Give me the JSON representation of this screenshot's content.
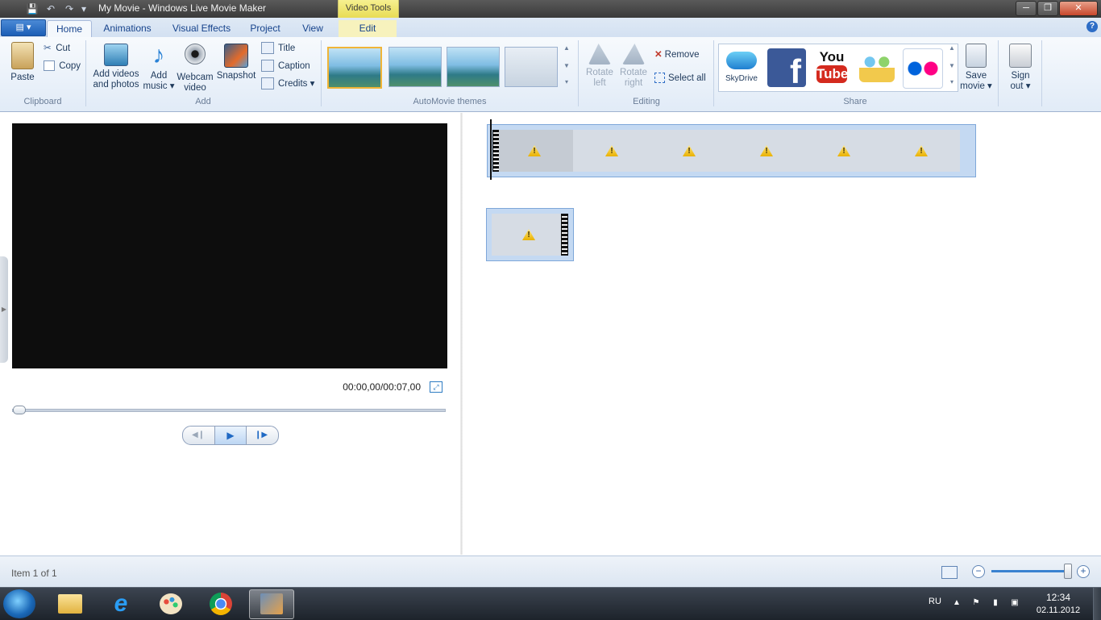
{
  "window": {
    "title": "My Movie - Windows Live Movie Maker",
    "contextual_tab_group": "Video Tools",
    "controls": {
      "minimize": "─",
      "maximize": "❐",
      "close": "✕"
    }
  },
  "quick_access": {
    "save_icon": "💾",
    "undo_icon": "↶",
    "redo_icon": "↷",
    "customize_icon": "▾"
  },
  "ribbon_tabs": [
    {
      "label": "Home",
      "active": true
    },
    {
      "label": "Animations",
      "active": false
    },
    {
      "label": "Visual Effects",
      "active": false
    },
    {
      "label": "Project",
      "active": false
    },
    {
      "label": "View",
      "active": false
    },
    {
      "label": "Edit",
      "active": false
    }
  ],
  "app_menu": {
    "icon": "▤ ▾"
  },
  "help": {
    "icon": "?"
  },
  "clipboard": {
    "group_label": "Clipboard",
    "paste": "Paste",
    "cut": "Cut",
    "copy": "Copy"
  },
  "add": {
    "group_label": "Add",
    "add_videos_line1": "Add videos",
    "add_videos_line2": "and photos",
    "add_music_line1": "Add",
    "add_music_line2": "music ▾",
    "webcam_line1": "Webcam",
    "webcam_line2": "video",
    "snapshot": "Snapshot",
    "title": "Title",
    "caption": "Caption",
    "credits": "Credits ▾"
  },
  "themes": {
    "group_label": "AutoMovie themes"
  },
  "editing": {
    "group_label": "Editing",
    "rotate_left_line1": "Rotate",
    "rotate_left_line2": "left",
    "rotate_right_line1": "Rotate",
    "rotate_right_line2": "right",
    "remove": "Remove",
    "select_all": "Select all"
  },
  "share": {
    "group_label": "Share",
    "skydrive": "SkyDrive",
    "youtube_line1": "You",
    "youtube_line2": "Tube",
    "save_movie_line1": "Save",
    "save_movie_line2": "movie ▾",
    "sign_out_line1": "Sign",
    "sign_out_line2": "out ▾"
  },
  "preview": {
    "time": "00:00,00/00:07,00",
    "fullscreen_icon": "⤢",
    "prev_frame_icon": "◀❙",
    "play_icon": "▶",
    "next_frame_icon": "❙▶"
  },
  "status": {
    "item_text": "Item 1 of 1"
  },
  "zoom": {
    "minus": "−",
    "plus": "+"
  },
  "taskbar": {
    "language": "RU",
    "time": "12:34",
    "date": "02.11.2012",
    "tray_arrow": "▲"
  },
  "colors": {
    "accent": "#2d6dc6",
    "ribbon_bg": "#e1ebf7",
    "contextual_tab": "#f2e878",
    "clip_bg": "#c4d9f2"
  }
}
